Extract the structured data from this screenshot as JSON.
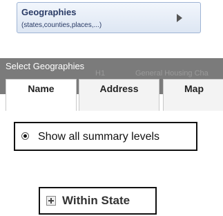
{
  "geographies_button": {
    "title": "Geographies",
    "subtitle": "(states,counties,places,...)"
  },
  "select_panel": {
    "title": "Select Geographies",
    "background_text": [
      "H1",
      "General Housing Cha"
    ],
    "tabs": [
      {
        "label": "Name",
        "active": true
      },
      {
        "label": "Address",
        "active": false
      },
      {
        "label": "Map",
        "active": false
      }
    ]
  },
  "summary_option": {
    "label": "Show all summary levels",
    "selected": true
  },
  "within_state": {
    "label": "Within State"
  }
}
